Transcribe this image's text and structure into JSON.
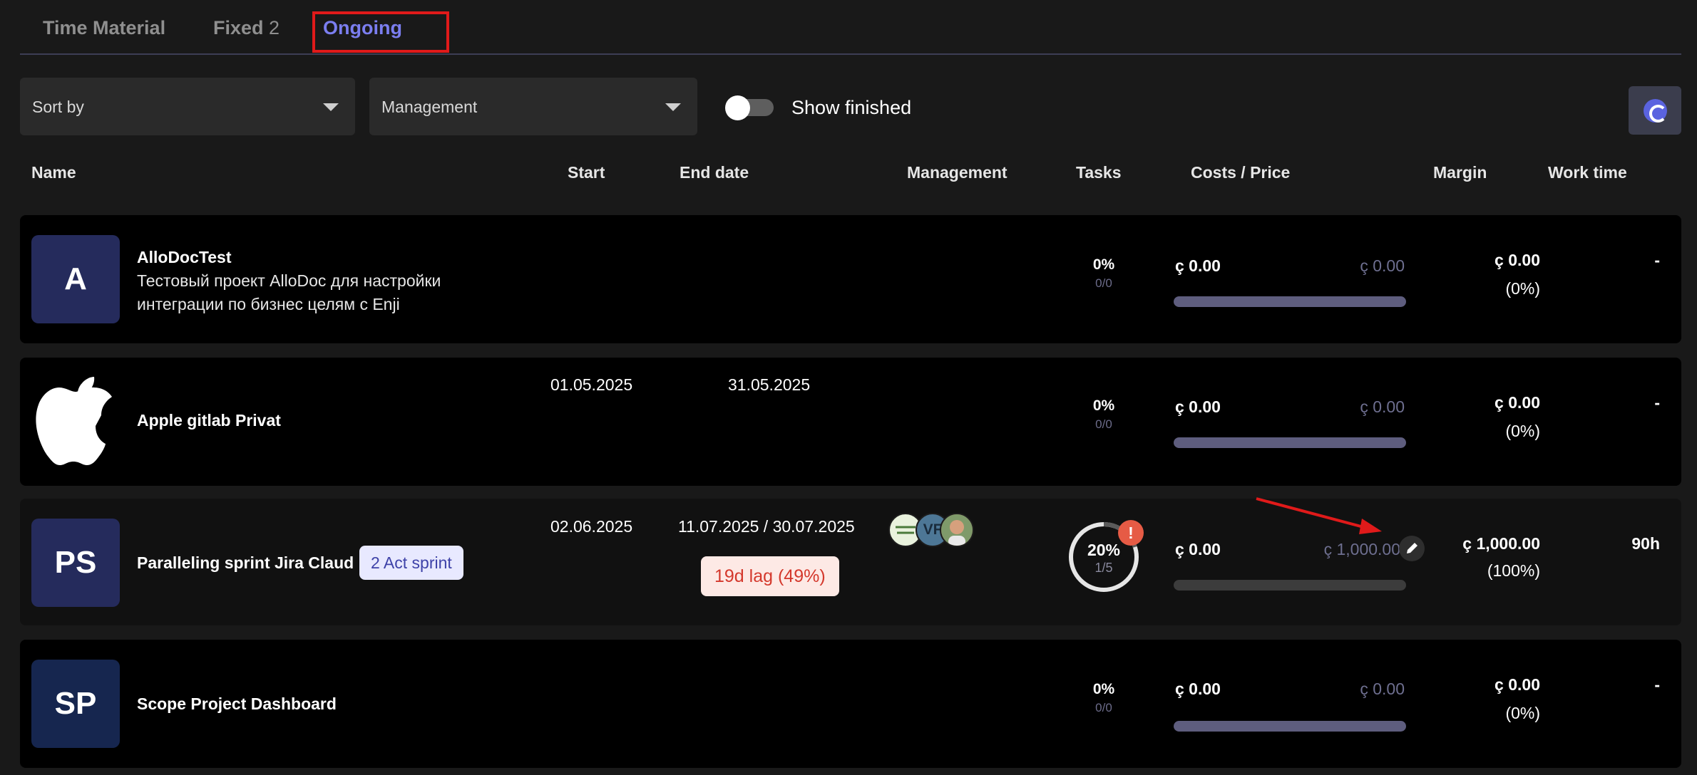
{
  "tabs": [
    {
      "label": "Time Material",
      "count": ""
    },
    {
      "label": "Fixed",
      "count": "2"
    },
    {
      "label": "Ongoing",
      "count": ""
    }
  ],
  "active_tab": "Ongoing",
  "toolbar": {
    "sort_label": "Sort by",
    "management_label": "Management",
    "show_finished_label": "Show finished",
    "show_finished_on": false
  },
  "headers": {
    "name": "Name",
    "start": "Start",
    "end_date": "End date",
    "management": "Management",
    "tasks": "Tasks",
    "costs_price": "Costs / Price",
    "margin": "Margin",
    "work_time": "Work time"
  },
  "projects": [
    {
      "avatar": "A",
      "name": "AlloDocTest",
      "description_line1": "Тестовый проект AlloDoc для настройки",
      "description_line2": "интеграции по бизнес целям с Enji",
      "start": "",
      "end": "",
      "tasks_pct": "0%",
      "tasks_frac": "0/0",
      "cost": "ç 0.00",
      "price": "ç 0.00",
      "margin": "ç 0.00",
      "margin_pct": "(0%)",
      "work_time": "-"
    },
    {
      "avatar": "apple-logo",
      "name": "Apple gitlab Privat",
      "start": "01.05.2025",
      "end": "31.05.2025",
      "tasks_pct": "0%",
      "tasks_frac": "0/0",
      "cost": "ç 0.00",
      "price": "ç 0.00",
      "margin": "ç 0.00",
      "margin_pct": "(0%)",
      "work_time": "-"
    },
    {
      "avatar": "PS",
      "name": "Paralleling sprint Jira Claud",
      "badge": "2 Act sprint",
      "start": "02.06.2025",
      "end": "11.07.2025 / 30.07.2025",
      "lag": "19d lag (49%)",
      "managers": [
        "logo-avatar",
        "VF",
        "photo-avatar"
      ],
      "tasks_pct": "20%",
      "tasks_frac": "1/5",
      "tasks_progress": 0.2,
      "alert": "!",
      "cost": "ç 0.00",
      "price": "ç 1,000.00",
      "margin": "ç 1,000.00",
      "margin_pct": "(100%)",
      "work_time": "90h"
    },
    {
      "avatar": "SP",
      "name": "Scope Project Dashboard",
      "start": "",
      "end": "",
      "tasks_pct": "0%",
      "tasks_frac": "0/0",
      "cost": "ç 0.00",
      "price": "ç 0.00",
      "margin": "ç 0.00",
      "margin_pct": "(0%)",
      "work_time": "-"
    }
  ],
  "colors": {
    "accent": "#7b7ef0",
    "annotation_red": "#e01a1a",
    "lag_text": "#d4382c",
    "alert": "#e65b45"
  }
}
